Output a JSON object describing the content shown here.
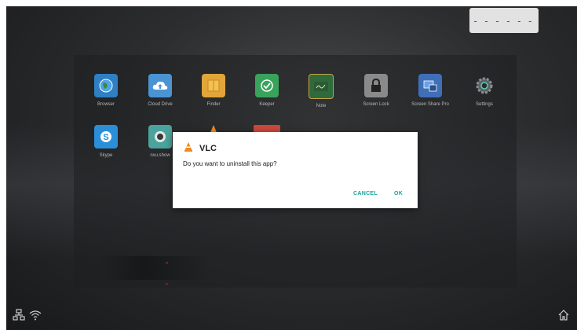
{
  "top_bar": {
    "indicator_text": "- - - - - -"
  },
  "apps_row1": [
    {
      "label": "Browser",
      "icon": "globe-icon",
      "color": "#2f7fc4"
    },
    {
      "label": "Cloud Drive",
      "icon": "cloud-upload-icon",
      "color": "#4b94d4"
    },
    {
      "label": "Finder",
      "icon": "folder-icon",
      "color": "#e2a53a"
    },
    {
      "label": "Keeper",
      "icon": "check-icon",
      "color": "#39a35c"
    },
    {
      "label": "Note",
      "icon": "note-board-icon",
      "color": "#2f6b3a"
    },
    {
      "label": "Screen Lock",
      "icon": "lock-icon",
      "color": "#8a8a8a"
    },
    {
      "label": "Screen Share Pro",
      "icon": "screen-share-icon",
      "color": "#3f6fb8"
    },
    {
      "label": "Settings",
      "icon": "gear-icon",
      "color": "#3a3f44"
    }
  ],
  "apps_row2": [
    {
      "label": "Skype",
      "icon": "skype-icon",
      "color": "#2a8fd8"
    },
    {
      "label": "nxu.show",
      "icon": "record-icon",
      "color": "#4aa39c"
    },
    {
      "label": "",
      "icon": "vlc-cone-icon",
      "color": "#f08a1c"
    },
    {
      "label": "",
      "icon": "app-red-icon",
      "color": "#c9483c"
    }
  ],
  "dialog": {
    "title": "VLC",
    "message": "Do you want to uninstall this app?",
    "cancel_label": "CANCEL",
    "ok_label": "OK",
    "accent": "#1aa39a"
  },
  "bottom_bar": {
    "left_icons": [
      "network-icon",
      "wifi-icon"
    ],
    "right_icons": [
      "home-icon"
    ]
  }
}
